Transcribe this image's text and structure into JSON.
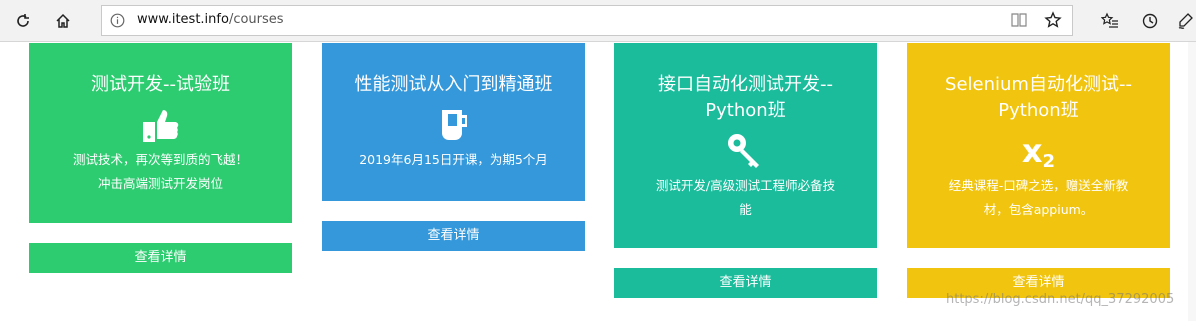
{
  "browser": {
    "url_host": "www.itest.info",
    "url_path": "/courses",
    "icons": [
      "refresh-icon",
      "home-icon",
      "info-icon",
      "reader-view-icon",
      "favorite-star-icon",
      "favorites-list-icon",
      "history-icon",
      "pen-icon"
    ]
  },
  "cards": [
    {
      "title": "测试开发--试验班",
      "icon": "thumbs-up-icon",
      "desc_line1": "测试技术，再次等到质的飞越！",
      "desc_line2": "冲击高端测试开发岗位",
      "button": "查看详情",
      "color": "#2ecc71"
    },
    {
      "title": "性能测试从入门到精通班",
      "icon": "cup-icon",
      "desc_line1": "2019年6月15日开课，为期5个月",
      "desc_line2": "",
      "button": "查看详情",
      "color": "#3498db"
    },
    {
      "title_line1": "接口自动化测试开发--",
      "title_line2": "Python班",
      "icon": "key-icon",
      "desc_line1": "测试开发/高级测试工程师必备技",
      "desc_line2": "能",
      "button": "查看详情",
      "color": "#1abc9c"
    },
    {
      "title_line1": "Selenium自动化测试--",
      "title_line2": "Python班",
      "icon": "subscript-icon",
      "icon_text": "x",
      "icon_sub": "2",
      "desc_line1": "经典课程-口碑之选，赠送全新教",
      "desc_line2": "材，包含appium。",
      "button": "查看详情",
      "color": "#f1c40f"
    }
  ],
  "watermark": "https://blog.csdn.net/qq_37292005"
}
